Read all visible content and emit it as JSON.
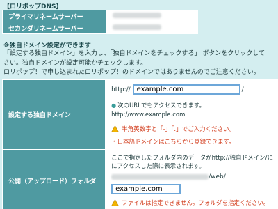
{
  "dns": {
    "title": "【ロリポップDNS】",
    "primary_label": "プライマリネームサーバー",
    "secondary_label": "セカンダリネームサーバー"
  },
  "section": {
    "heading": "※独自ドメイン設定ができます",
    "notice_lines": [
      "「設定する独自ドメイン」を入力し、「独自ドメインをチェックする」 ボタンをクリックして",
      "さい。独自ドメインが設定可能かチェックします。",
      "ロリポップ！で申し込まれたロリポップ！のドメインではありませんのでご注意ください。"
    ]
  },
  "custom_domain": {
    "label": "設定する独自ドメイン",
    "prefix": "http://",
    "value": "example.com",
    "suffix": "/",
    "info": "次のURLでもアクセスできます。",
    "www_url": "http://www.example.com",
    "warning": "半角英数字と「-」「.」でご入力ください。",
    "japanese_link": "・日本語ドメインはこちらから登録できます。"
  },
  "upload_folder": {
    "label": "公開（アップロード）フォルダ",
    "desc_lines": [
      "ここで指定したフォルダ内のデータがhttp://独自ドメイン/に",
      "にアクセスした際に表示されます。"
    ],
    "path_suffix": "/web/",
    "value": "example.com",
    "warning": "ファイルは指定できません。フォルダを指定ください。"
  },
  "colors": {
    "label_bg": "#4f9aa1",
    "page_bg": "#d4eef0",
    "warning": "#d23a1a"
  }
}
